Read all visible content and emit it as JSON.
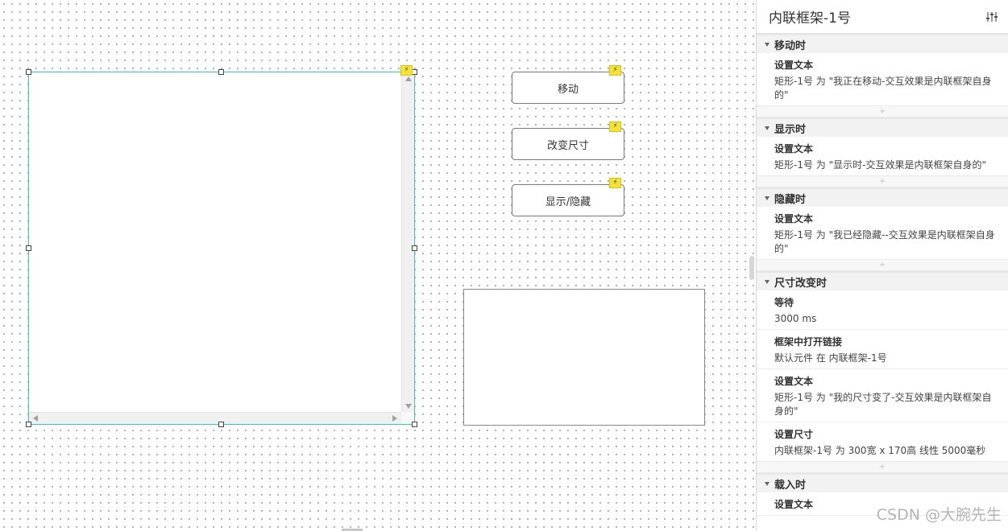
{
  "buttons": {
    "move": "移动",
    "resize": "改变尺寸",
    "toggle": "显示/隐藏"
  },
  "panel": {
    "title": "内联框架-1号",
    "add_symbol": "+",
    "events": [
      {
        "name": "移动时",
        "actions": [
          {
            "name": "设置文本",
            "detail": "矩形-1号 为 \"我正在移动-交互效果是内联框架自身的\""
          }
        ]
      },
      {
        "name": "显示时",
        "actions": [
          {
            "name": "设置文本",
            "detail": "矩形-1号 为 \"显示时-交互效果是内联框架自身的\""
          }
        ]
      },
      {
        "name": "隐藏时",
        "actions": [
          {
            "name": "设置文本",
            "detail": "矩形-1号 为 \"我已经隐藏--交互效果是内联框架自身的\""
          }
        ]
      },
      {
        "name": "尺寸改变时",
        "actions": [
          {
            "name": "等待",
            "detail": "3000 ms"
          },
          {
            "name": "框架中打开链接",
            "detail": "默认元件 在 内联框架-1号"
          },
          {
            "name": "设置文本",
            "detail": "矩形-1号 为 \"我的尺寸变了-交互效果是内联框架自身的\""
          },
          {
            "name": "设置尺寸",
            "detail": "内联框架-1号 为 300宽 x 170高 线性 5000毫秒"
          }
        ]
      },
      {
        "name": "载入时",
        "actions": [
          {
            "name": "设置文本",
            "detail": ""
          }
        ]
      }
    ]
  },
  "watermark": "CSDN @大腕先生",
  "colors": {
    "selection": "#3ac1d3",
    "bolt": "#f3e23a"
  },
  "icons": [
    "bolt-icon",
    "settings-sliders-icon",
    "caret-down-icon"
  ]
}
